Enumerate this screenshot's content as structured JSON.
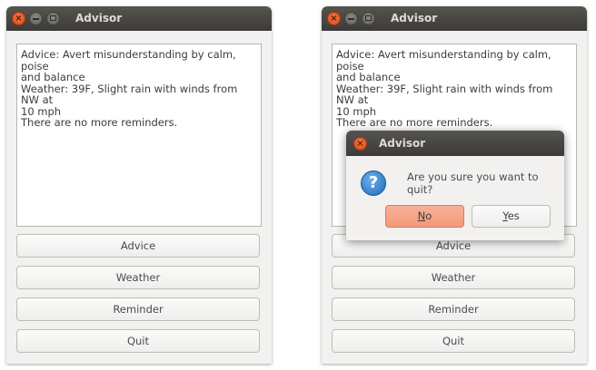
{
  "window_left": {
    "title": "Advisor",
    "text_lines": [
      "Advice: Avert misunderstanding by calm, poise",
      "and balance",
      "Weather: 39F, Slight rain with winds from NW at",
      "10 mph",
      "There are no more reminders."
    ],
    "buttons": {
      "advice": "Advice",
      "weather": "Weather",
      "reminder": "Reminder",
      "quit": "Quit"
    }
  },
  "window_right": {
    "title": "Advisor",
    "text_lines": [
      "Advice: Avert misunderstanding by calm, poise",
      "and balance",
      "Weather: 39F, Slight rain with winds from NW at",
      "10 mph",
      "There are no more reminders."
    ],
    "buttons": {
      "advice": "Advice",
      "weather": "Weather",
      "reminder": "Reminder",
      "quit": "Quit"
    }
  },
  "dialog": {
    "title": "Advisor",
    "message": "Are you sure you want to quit?",
    "icon": "question-icon",
    "no_label_mnemonic": "N",
    "no_label_rest": "o",
    "yes_label_mnemonic": "Y",
    "yes_label_rest": "es"
  },
  "colors": {
    "titlebar": "#3c3b37",
    "close_button": "#dd4814",
    "default_button": "#f39a7a",
    "question_icon": "#1f69b5"
  },
  "icons": {
    "close": "close-icon",
    "minimize": "minimize-icon",
    "maximize": "maximize-icon"
  }
}
